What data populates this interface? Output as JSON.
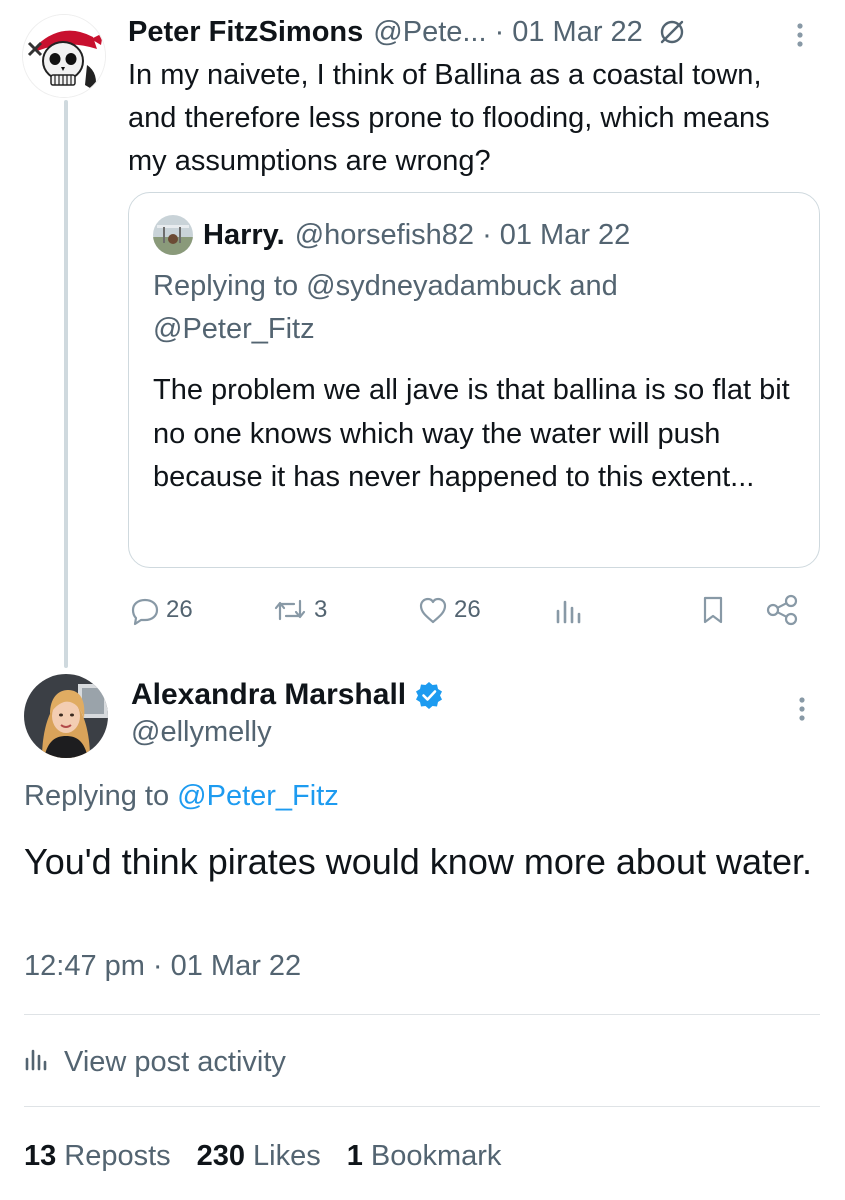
{
  "parent_tweet": {
    "display_name": "Peter FitzSimons",
    "handle": "@Pete...",
    "separator": "·",
    "date": "01 Mar 22",
    "body": "In my naivete, I think of Ballina as a coastal town, and therefore less prone to flooding, which means my assumptions are wrong?",
    "avatar_icon": "pirate-skull-icon",
    "actions": {
      "replies": "26",
      "reposts": "3",
      "likes": "26"
    }
  },
  "quoted_tweet": {
    "display_name": "Harry.",
    "handle": "@horsefish82",
    "separator": "·",
    "date": "01 Mar 22",
    "replying_prefix": "Replying to",
    "replying_to_1": "@sydneyadambuck",
    "replying_and": "and",
    "replying_to_2": "@Peter_Fitz",
    "body": "The problem we all jave is that ballina is so flat bit no one knows which way the water will push because it has never happened to this extent..."
  },
  "reply_tweet": {
    "display_name": "Alexandra Marshall",
    "handle": "@ellymelly",
    "replying_prefix": "Replying to",
    "replying_to": "@Peter_Fitz",
    "body": "You'd think pirates would know more about water.",
    "time": "12:47 pm",
    "separator": "·",
    "date": "01 Mar 22",
    "view_activity": "View post activity",
    "stats": {
      "reposts_count": "13",
      "reposts_label": "Reposts",
      "likes_count": "230",
      "likes_label": "Likes",
      "bookmarks_count": "1",
      "bookmarks_label": "Bookmark"
    }
  },
  "colors": {
    "text_primary": "#0f1419",
    "text_secondary": "#536471",
    "link": "#1d9bf0",
    "border": "#cfd9de",
    "verified": "#1d9bf0"
  }
}
